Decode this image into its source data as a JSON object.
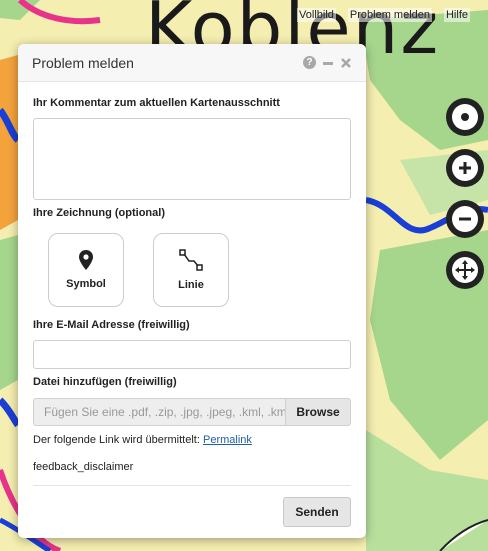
{
  "map": {
    "title": "Koblenz",
    "colors": {
      "base": "#f4eeb0",
      "green": "#a6d68c",
      "orange": "#f4a23c",
      "river": "#1a3fd6",
      "border": "#e8338a"
    }
  },
  "toplinks": {
    "fullscreen": "Vollbild",
    "report": "Problem melden",
    "help": "Hilfe"
  },
  "controls": {
    "center": "target-icon",
    "zoom_in": "plus-icon",
    "zoom_out": "minus-icon",
    "pan": "move-icon"
  },
  "dialog": {
    "title": "Problem melden",
    "comment_label": "Ihr Kommentar zum aktuellen Kartenausschnitt",
    "comment_value": "",
    "drawing_label": "Ihre Zeichnung (optional)",
    "symbol_label": "Symbol",
    "line_label": "Linie",
    "email_label": "Ihre E-Mail Adresse (freiwillig)",
    "email_value": "",
    "file_label": "Datei hinzufügen (freiwillig)",
    "file_placeholder": "Fügen Sie eine .pdf, .zip, .jpg, .jpeg, .kml, .kmz",
    "browse_label": "Browse",
    "link_text": "Der folgende Link wird übermittelt:",
    "permalink_label": "Permalink",
    "disclaimer": "feedback_disclaimer",
    "send_label": "Senden"
  }
}
